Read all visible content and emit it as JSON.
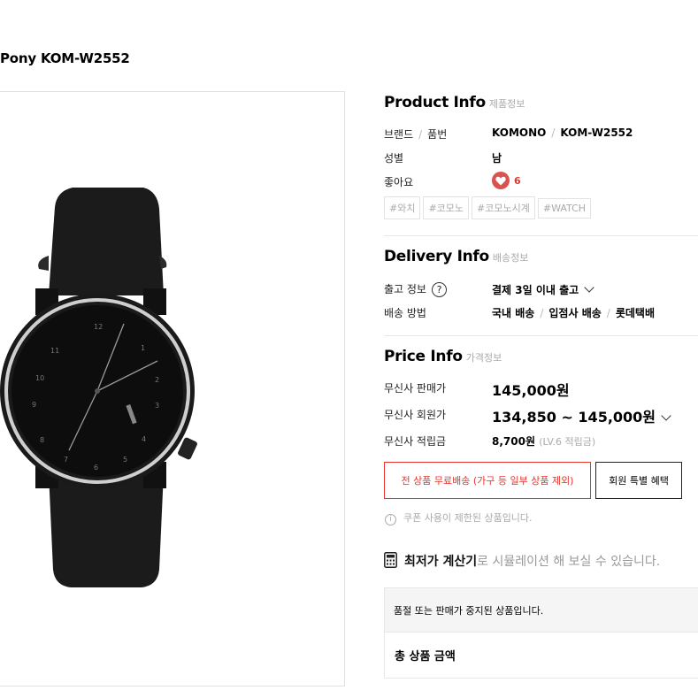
{
  "product": {
    "name": "Pony KOM-W2552"
  },
  "product_info": {
    "title": "Product Info",
    "subtitle": "제품정보",
    "brand_label": "브랜드",
    "sku_label": "품번",
    "brand": "KOMONO",
    "sku": "KOM-W2552",
    "gender_label": "성별",
    "gender": "남",
    "likes_label": "좋아요",
    "likes": "6",
    "tags": [
      "#와치",
      "#코모노",
      "#코모노시계",
      "#WATCH"
    ]
  },
  "delivery_info": {
    "title": "Delivery Info",
    "subtitle": "배송정보",
    "dispatch_label": "출고 정보",
    "dispatch_value": "결제 3일 이내 출고",
    "method_label": "배송 방법",
    "methods": [
      "국내 배송",
      "입점사 배송",
      "롯데택배"
    ]
  },
  "price_info": {
    "title": "Price Info",
    "subtitle": "가격정보",
    "sale_label": "무신사 판매가",
    "sale_price": "145,000원",
    "member_label": "무신사 회원가",
    "member_price": "134,850 ~ 145,000원",
    "points_label": "무신사 적립금",
    "points": "8,700원",
    "points_note": "(LV.6 적립금)"
  },
  "buttons": {
    "free_shipping": "전 상품 무료배송 (가구 등 일부 상품 제외)",
    "member_benefit": "회원 특별 혜택"
  },
  "coupon_notice": "쿠폰 사용이 제한된 상품입니다.",
  "calculator": {
    "strong": "최저가 계산기",
    "rest": "로 시뮬레이션 해 보실 수 있습니다."
  },
  "soldout_notice": "품절 또는 판매가 중지된 상품입니다.",
  "total_label": "총 상품 금액",
  "colors": {
    "accent": "#e5342c",
    "text": "#000000",
    "muted": "#aaaaaa",
    "border": "#e6e6e6"
  },
  "icons": [
    "heart-icon",
    "help-icon",
    "chevron-down-icon",
    "info-icon",
    "calculator-icon"
  ]
}
